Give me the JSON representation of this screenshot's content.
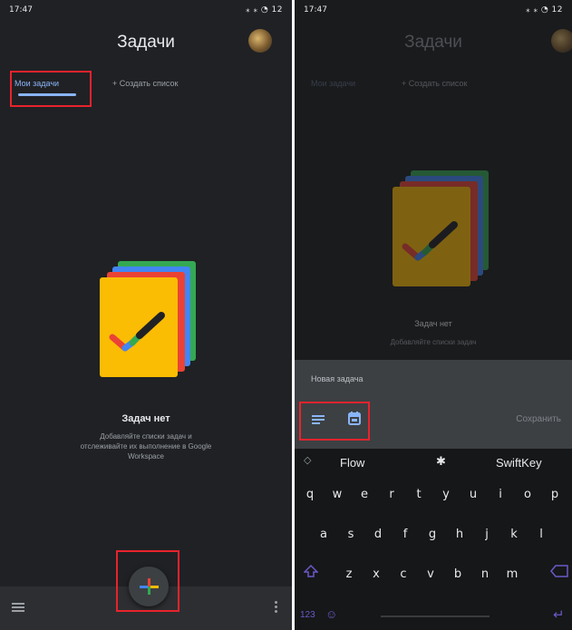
{
  "status": {
    "time": "17:47",
    "icons": "⁎ ⁎ ◔ 12"
  },
  "left": {
    "title": "Задачи",
    "tabs": {
      "my": "Мои задачи",
      "create": "+ Создать список"
    },
    "empty": {
      "title": "Задач нет",
      "desc_line1": "Добавляйте списки задач и",
      "desc_line2": "отслеживайте их выполнение в Google",
      "desc_line3": "Workspace"
    }
  },
  "right": {
    "title": "Задачи",
    "tabs": {
      "my": "Мои задачи",
      "create": "+ Создать список"
    },
    "empty": {
      "title": "Задач нет",
      "desc": "Добавляйте списки задач"
    },
    "sheet": {
      "placeholder": "Новая задача",
      "save": "Сохранить"
    },
    "keyboard": {
      "suggestions": [
        "Flow",
        "SwiftKey"
      ],
      "row1": [
        "q",
        "w",
        "e",
        "r",
        "t",
        "y",
        "u",
        "i",
        "o",
        "p"
      ],
      "row2": [
        "a",
        "s",
        "d",
        "f",
        "g",
        "h",
        "j",
        "k",
        "l"
      ],
      "row3": [
        "z",
        "x",
        "c",
        "v",
        "b",
        "n",
        "m"
      ],
      "numbers_key": "123"
    }
  },
  "colors": {
    "accent": "#8ab4f8",
    "highlight": "#e8232d",
    "background": "#202124"
  }
}
